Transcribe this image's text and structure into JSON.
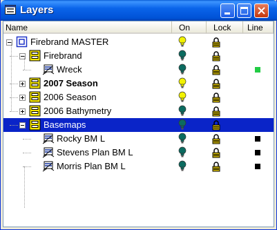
{
  "window": {
    "title": "Layers",
    "title_icon": "layers-icon"
  },
  "columns": {
    "name": "Name",
    "on": "On",
    "lock": "Lock",
    "line": "Line"
  },
  "rows": [
    {
      "label": "Firebrand MASTER",
      "bold": false,
      "icon": "master-layer-icon",
      "expander": "minus",
      "on_icon": "bulb-on-icon",
      "lock_icon": "lock-icon",
      "line_color": null,
      "selected": false
    },
    {
      "label": "Firebrand",
      "bold": false,
      "icon": "group-layer-icon",
      "expander": "minus",
      "on_icon": "bulb-dark-icon",
      "lock_icon": "lock-icon",
      "line_color": null,
      "selected": false
    },
    {
      "label": "Wreck",
      "bold": false,
      "icon": "vector-layer-icon",
      "expander": null,
      "on_icon": "bulb-dark-icon",
      "lock_icon": "lock-icon",
      "line_color": "#22cc44",
      "selected": false
    },
    {
      "label": "2007 Season",
      "bold": true,
      "icon": "group-layer-icon",
      "expander": "plus",
      "on_icon": "bulb-on-icon",
      "lock_icon": "lock-icon",
      "line_color": null,
      "selected": false
    },
    {
      "label": "2006 Season",
      "bold": false,
      "icon": "group-layer-icon",
      "expander": "plus",
      "on_icon": "bulb-on-icon",
      "lock_icon": "lock-icon",
      "line_color": null,
      "selected": false
    },
    {
      "label": "2006 Bathymetry",
      "bold": false,
      "icon": "group-layer-icon",
      "expander": "plus",
      "on_icon": "bulb-dark-icon",
      "lock_icon": "lock-icon",
      "line_color": null,
      "selected": false
    },
    {
      "label": "Basemaps",
      "bold": false,
      "icon": "group-layer-icon",
      "expander": "minus",
      "on_icon": "bulb-dark-icon",
      "lock_icon": "lock-icon",
      "line_color": null,
      "selected": true
    },
    {
      "label": "Rocky BM L",
      "bold": false,
      "icon": "vector-layer-icon",
      "expander": null,
      "on_icon": "bulb-dark-icon",
      "lock_icon": "lock-icon",
      "line_color": "#000000",
      "selected": false
    },
    {
      "label": "Stevens Plan BM L",
      "bold": false,
      "icon": "vector-layer-icon",
      "expander": null,
      "on_icon": "bulb-dark-icon",
      "lock_icon": "lock-icon",
      "line_color": "#000000",
      "selected": false
    },
    {
      "label": "Morris Plan BM  L",
      "bold": false,
      "icon": "vector-layer-icon",
      "expander": null,
      "on_icon": "bulb-dark-icon",
      "lock_icon": "lock-icon",
      "line_color": "#000000",
      "selected": false
    }
  ]
}
